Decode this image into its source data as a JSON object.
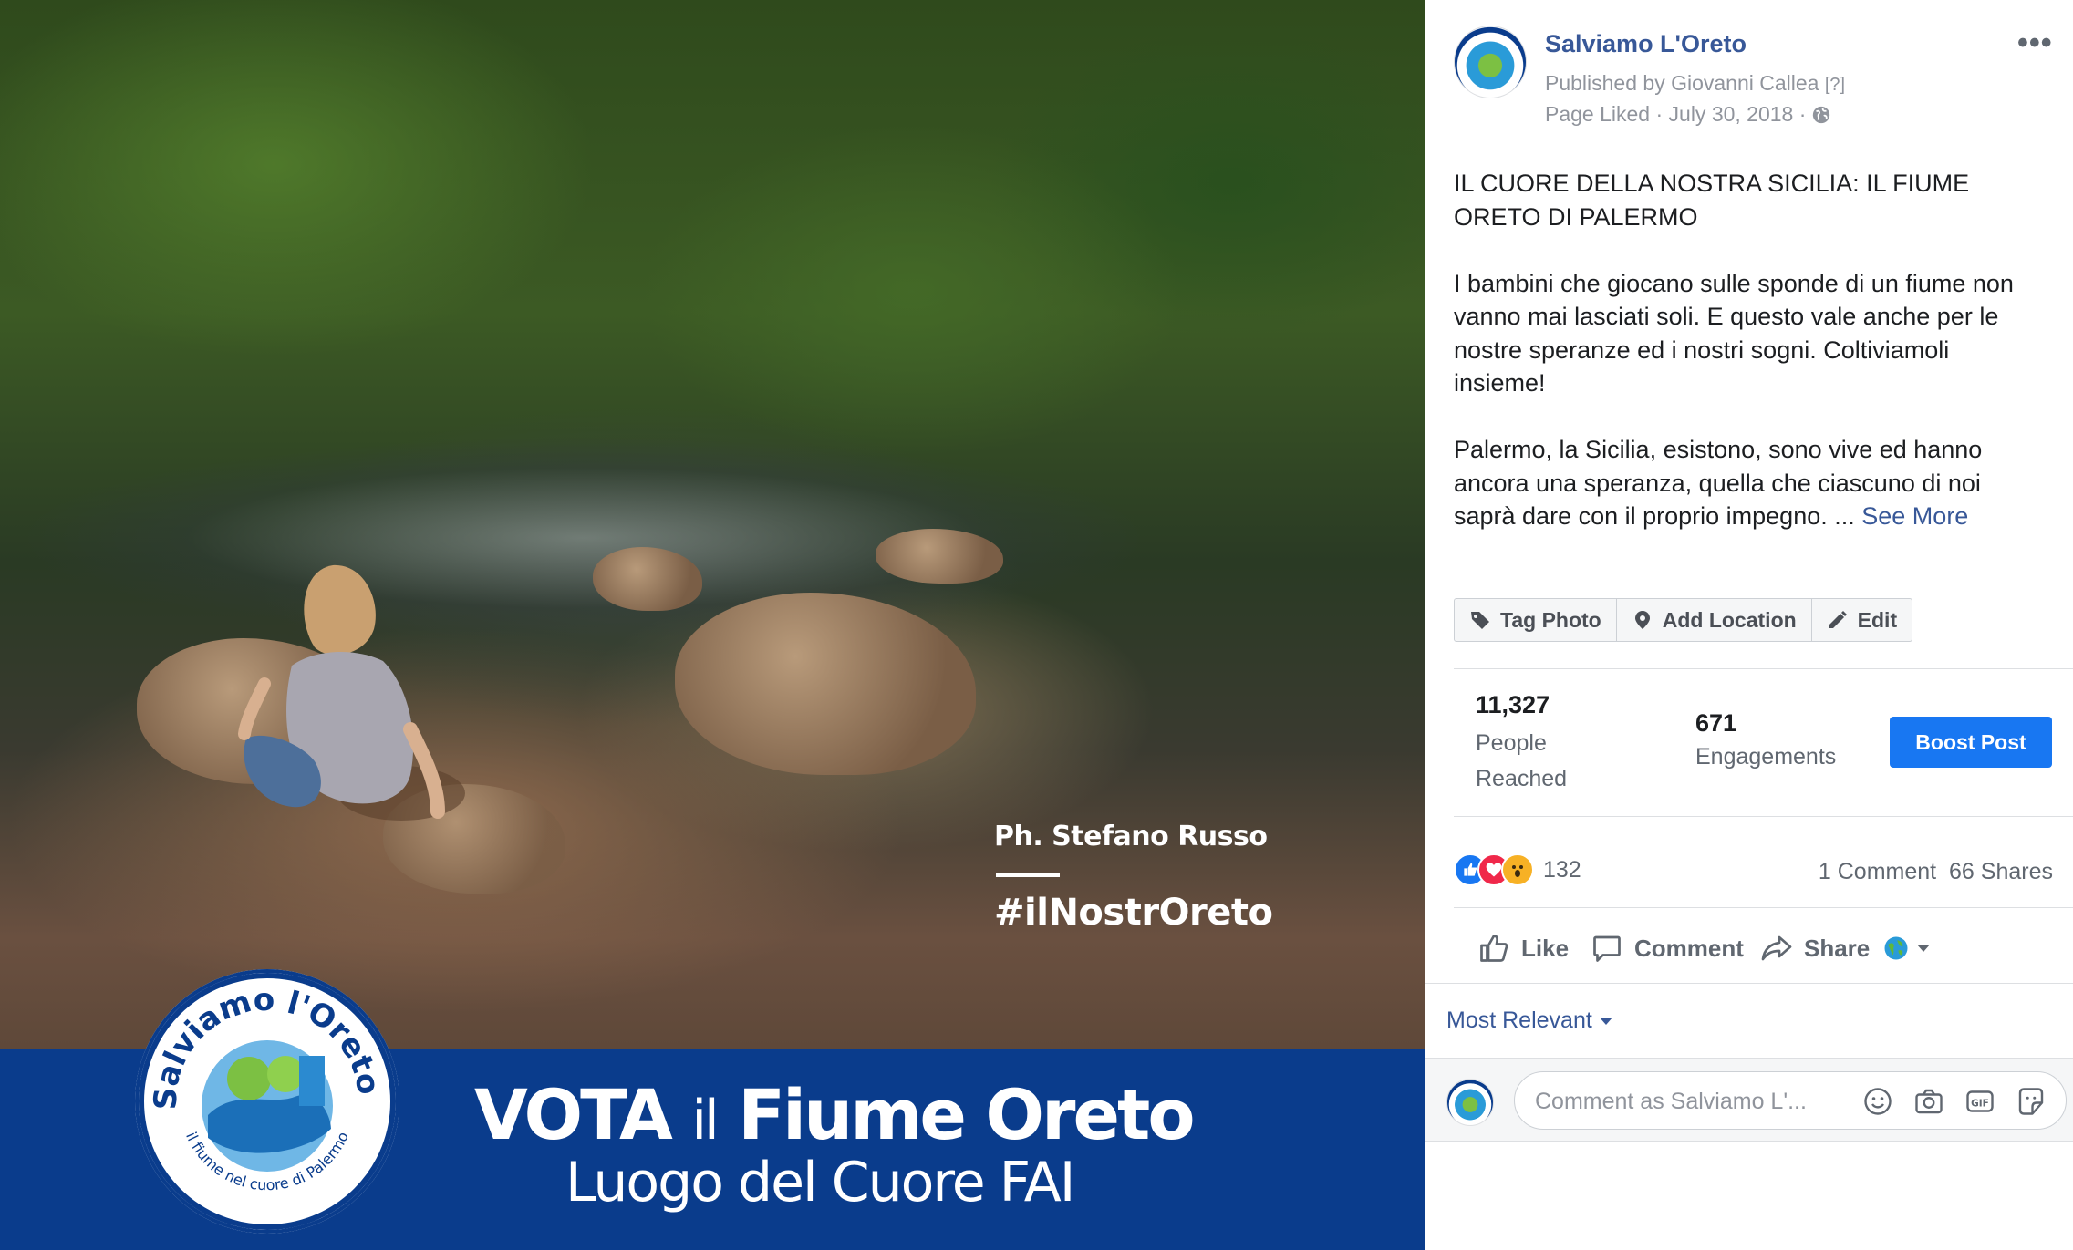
{
  "photo": {
    "credit": "Ph. Stefano Russo",
    "hashtag": "#ilNostrOreto",
    "banner_title_a": "VOTA ",
    "banner_title_il": "il",
    "banner_title_b": " Fiume Oreto",
    "banner_subtitle": "Luogo del Cuore FAI",
    "logo_text_top": "Salviamo l'Oreto!",
    "logo_text_bottom": "il fiume nel cuore di Palermo"
  },
  "post": {
    "page_name": "Salviamo L'Oreto",
    "published_by": "Published by Giovanni Callea",
    "published_q": "[?]",
    "page_liked_date": "Page Liked · July 30, 2018 ·",
    "paragraph1": "IL CUORE DELLA NOSTRA SICILIA: IL FIUME ORETO DI PALERMO",
    "paragraph2": "I bambini che giocano sulle sponde di un fiume non vanno mai lasciati soli. E questo vale anche per le nostre speranze ed i nostri sogni. Coltiviamoli insieme!",
    "paragraph3": "Palermo, la Sicilia, esistono, sono vive ed hanno ancora una speranza, quella che ciascuno di noi saprà dare con il proprio impegno. ...",
    "see_more": "See More"
  },
  "photo_actions": {
    "tag_photo": "Tag Photo",
    "add_location": "Add Location",
    "edit": "Edit"
  },
  "stats": {
    "reached_value": "11,327",
    "reached_label": "People Reached",
    "engagements_value": "671",
    "engagements_label": "Engagements",
    "boost_label": "Boost Post"
  },
  "reactions": {
    "count": "132",
    "comments": "1 Comment",
    "shares": "66 Shares"
  },
  "actions": {
    "like": "Like",
    "comment": "Comment",
    "share": "Share"
  },
  "comments": {
    "sort_label": "Most Relevant",
    "input_placeholder": "Comment as Salviamo L'..."
  },
  "colors": {
    "link": "#385898",
    "boost": "#1877f2",
    "banner": "#0a3c8c"
  },
  "icons": [
    "more-icon",
    "globe-icon",
    "tag-icon",
    "location-pin-icon",
    "pencil-icon",
    "like-reaction-icon",
    "love-reaction-icon",
    "wow-reaction-icon",
    "thumbs-up-icon",
    "comment-bubble-icon",
    "share-arrow-icon",
    "audience-globe-icon",
    "emoji-icon",
    "camera-icon",
    "gif-icon",
    "sticker-icon"
  ]
}
